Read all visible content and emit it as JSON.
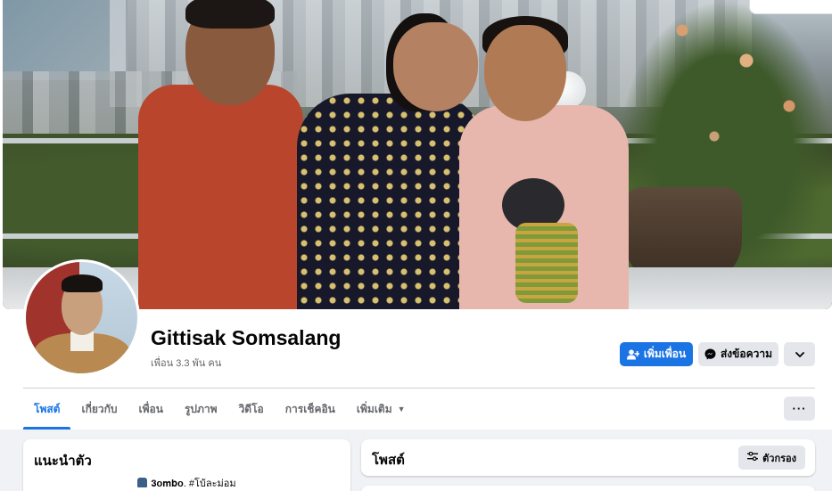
{
  "profile": {
    "name": "Gittisak Somsalang",
    "friend_count": "เพื่อน 3.3 พัน คน"
  },
  "actions": {
    "add_friend": "เพิ่มเพื่อน",
    "message": "ส่งข้อความ",
    "more_icon": "chevron-down-icon"
  },
  "tabs": [
    {
      "label": "โพสต์",
      "active": true
    },
    {
      "label": "เกี่ยวกับ",
      "active": false
    },
    {
      "label": "เพื่อน",
      "active": false
    },
    {
      "label": "รูปภาพ",
      "active": false
    },
    {
      "label": "วิดีโอ",
      "active": false
    },
    {
      "label": "การเช็คอิน",
      "active": false
    },
    {
      "label": "เพิ่มเติม",
      "active": false
    }
  ],
  "tab_more_label": "···",
  "intro": {
    "title": "แนะนำตัว",
    "bio": "𝟑𝐨𝐦𝐛𝐨. #โบ้ละม่อม"
  },
  "posts": {
    "title": "โพสต์",
    "filter_label": "ตัวกรอง"
  },
  "colors": {
    "accent": "#1b74e4",
    "background": "#f0f2f5",
    "secondary_button": "#e4e6eb",
    "muted_text": "#65676b"
  }
}
